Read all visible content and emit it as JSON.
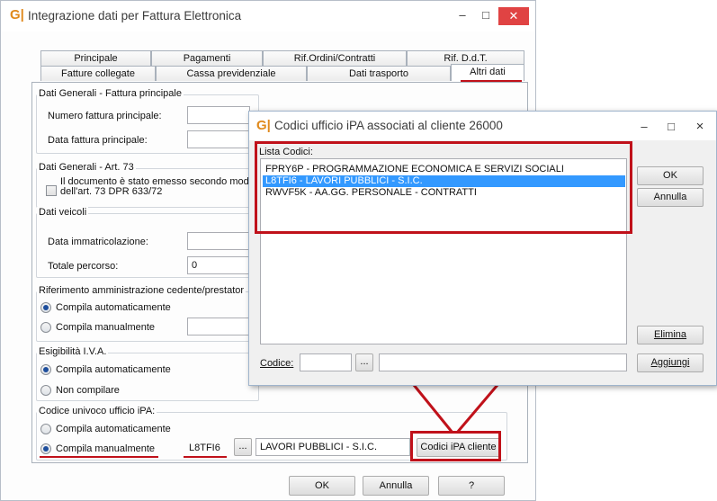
{
  "main_window": {
    "title": "Integrazione dati per Fattura Elettronica",
    "minimize": "–",
    "maximize": "□",
    "close": "✕"
  },
  "tabs_row1": [
    "Principale",
    "Pagamenti",
    "Rif.Ordini/Contratti",
    "Rif. D.d.T."
  ],
  "tabs_row2": [
    "Fatture collegate",
    "Cassa previdenziale",
    "Dati trasporto",
    "Altri dati"
  ],
  "sections": {
    "fattura_principale": {
      "title": "Dati Generali - Fattura principale",
      "numero_label": "Numero fattura principale:",
      "data_label": "Data fattura principale:"
    },
    "art73": {
      "title": "Dati Generali - Art. 73",
      "check_line1": "Il documento è stato emesso secondo mod",
      "check_line2": "dell'art. 73 DPR 633/72"
    },
    "veicoli": {
      "title": "Dati veicoli",
      "immatricolazione_label": "Data immatricolazione:",
      "percorso_label": "Totale percorso:",
      "percorso_value": "0"
    },
    "riferimento": {
      "title": "Riferimento amministrazione cedente/prestator",
      "auto_label": "Compila automaticamente",
      "manual_label": "Compila manualmente"
    },
    "esigibilita": {
      "title": "Esigibilità I.V.A.",
      "auto_label": "Compila automaticamente",
      "none_label": "Non compilare"
    },
    "codice_univoco": {
      "title": "Codice univoco ufficio iPA:",
      "auto_label": "Compila automaticamente",
      "manual_label": "Compila manualmente",
      "code_value": "L8TFI6",
      "browse_label": "...",
      "desc_value": "LAVORI PUBBLICI - S.I.C.",
      "ipa_button": "Codici iPA cliente"
    }
  },
  "footer": {
    "ok": "OK",
    "annulla": "Annulla",
    "help": "?"
  },
  "dialog": {
    "title": "Codici ufficio iPA associati al cliente 26000",
    "minimize": "–",
    "maximize": "□",
    "close": "×",
    "list_label": "Lista Codici:",
    "items": [
      "FPRY6P - PROGRAMMAZIONE ECONOMICA E SERVIZI SOCIALI",
      "L8TFI6 - LAVORI PUBBLICI - S.I.C.",
      "RWVF5K - AA.GG. PERSONALE - CONTRATTI"
    ],
    "ok": "OK",
    "annulla": "Annulla",
    "elimina": "Elimina",
    "codice_label": "Codice:",
    "browse": "...",
    "aggiungi": "Aggiungi"
  },
  "colors": {
    "highlight_red": "#c0111a",
    "selection_blue": "#3399ff",
    "close_red": "#e04343"
  }
}
